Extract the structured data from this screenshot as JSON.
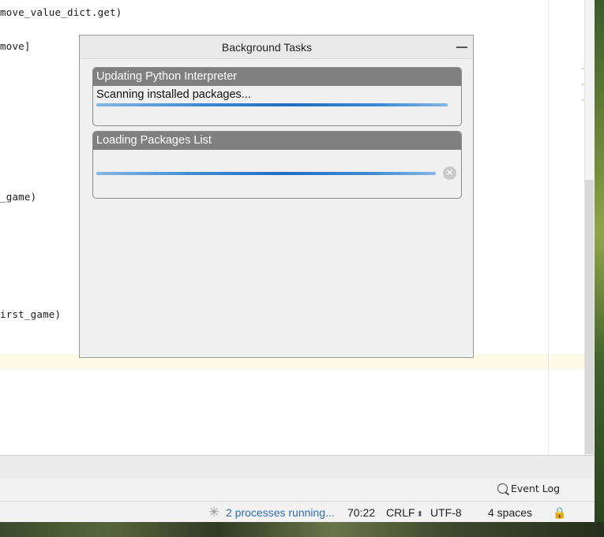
{
  "editor": {
    "lines": [
      {
        "text": "move_value_dict.get)"
      },
      {
        "text": "move]"
      },
      {
        "text": "_game)"
      },
      {
        "text": "irst_game)"
      }
    ]
  },
  "popup": {
    "title": "Background Tasks",
    "tasks": [
      {
        "title": "Updating Python Interpreter",
        "status": "Scanning installed packages..."
      },
      {
        "title": "Loading Packages List",
        "status": ""
      }
    ]
  },
  "event_log": {
    "label": "Event Log"
  },
  "status_bar": {
    "processes": "2 processes running...",
    "position": "70:22",
    "line_ending": "CRLF",
    "encoding": "UTF-8",
    "indent": "4 spaces"
  },
  "icons": {
    "minimize": "minimize-icon",
    "cancel": "cancel-icon",
    "event_log": "event-log-icon",
    "spinner": "spinner-icon",
    "lock": "lock-icon"
  },
  "colors": {
    "progress": "#1d6fc3",
    "task_header": "#808080",
    "processes_link": "#2f6fb0"
  }
}
